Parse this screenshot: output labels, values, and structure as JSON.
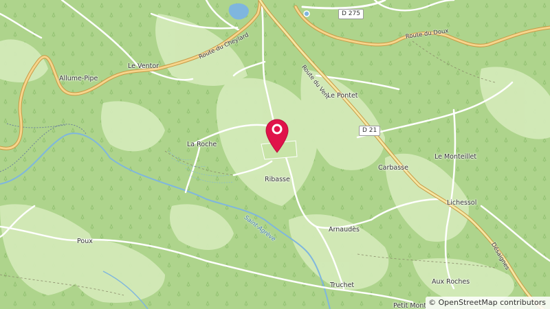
{
  "map": {
    "places": {
      "allume_pipe": "Allume-Pipe",
      "le_ventor": "Le Ventor",
      "la_roche": "La Roche",
      "ribasse": "Ribasse",
      "le_pontet": "Le Pontet",
      "carbasse": "Carbasse",
      "le_monteillet": "Le Monteillet",
      "lichessol": "Lichessol",
      "arnaudes": "Arnaudès",
      "poux": "Poux",
      "truchet": "Truchet",
      "aux_roches": "Aux Roches",
      "petit_mont": "Petit Mont"
    },
    "roads": {
      "d275": "D 275",
      "d21": "D 21",
      "route_du_cheylard": "Route du Cheylard",
      "route_du_doux": "Route du Doux",
      "route_du_vent": "Route du Vent",
      "dessaignes": "Désaignes"
    },
    "rivers": {
      "saint_agreve": "Saint-Agrève"
    },
    "marker": {
      "icon": "location-pin-icon",
      "color": "#e0134a"
    },
    "attribution": "© OpenStreetMap contributors",
    "colors": {
      "forest": "#aed48c",
      "meadow": "#d6ecbd",
      "major_road": "#f6d58c",
      "water": "#7fb6de"
    }
  }
}
